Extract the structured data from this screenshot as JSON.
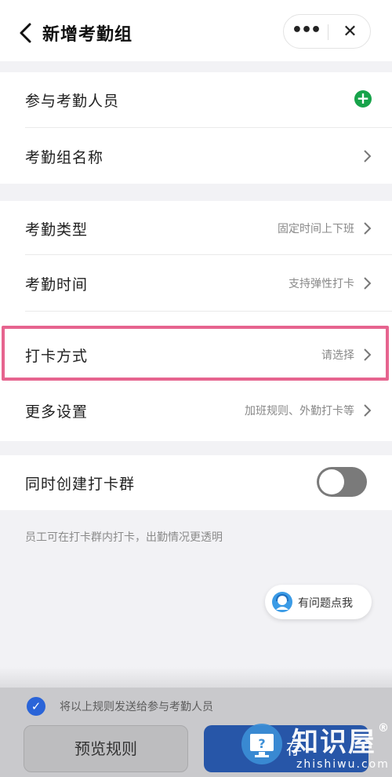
{
  "header": {
    "title": "新增考勤组",
    "more_label": "•••",
    "close_label": "✕"
  },
  "members_card": {
    "participants_label": "参与考勤人员",
    "group_name_label": "考勤组名称"
  },
  "rules_card": {
    "type_label": "考勤类型",
    "type_value": "固定时间上下班",
    "time_label": "考勤时间",
    "time_value": "支持弹性打卡",
    "method_label": "打卡方式",
    "method_value": "请选择",
    "more_label": "更多设置",
    "more_value": "加班规则、外勤打卡等"
  },
  "group_card": {
    "create_group_label": "同时创建打卡群",
    "toggle_on": false
  },
  "hint_text": "员工可在打卡群内打卡，出勤情况更透明",
  "help_button_label": "有问题点我",
  "bottom": {
    "send_label": "将以上规则发送给参与考勤人员",
    "preview_label": "预览规则",
    "save_label": "存"
  },
  "watermark": {
    "text": "知识屋",
    "reg": "®",
    "url": "zhishiwu.com"
  },
  "colors": {
    "accent": "#2756a8",
    "highlight": "#e6648f",
    "add_green": "#17a34a"
  }
}
